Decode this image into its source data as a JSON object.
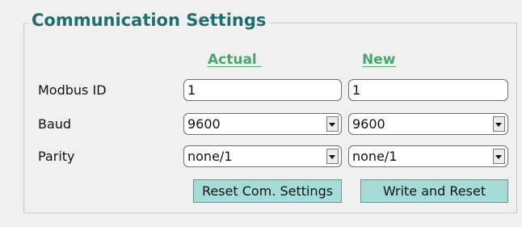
{
  "panel": {
    "title": "Communication Settings"
  },
  "columns": {
    "actual": "Actual ",
    "new": "New"
  },
  "rows": [
    {
      "label": "Modbus ID",
      "actual": "1",
      "new": "1",
      "kind": "text"
    },
    {
      "label": "Baud",
      "actual": "9600",
      "new": "9600",
      "kind": "select"
    },
    {
      "label": "Parity",
      "actual": "none/1",
      "new": "none/1",
      "kind": "select"
    }
  ],
  "buttons": {
    "reset": "Reset Com. Settings",
    "write": "Write and Reset"
  },
  "icons": {
    "dropdown": "chevron-down-icon"
  },
  "colors": {
    "title": "#1f6e73",
    "column_header": "#4aa66a",
    "button_bg": "#a6dcd8",
    "window_bg": "#f0f0f0"
  }
}
